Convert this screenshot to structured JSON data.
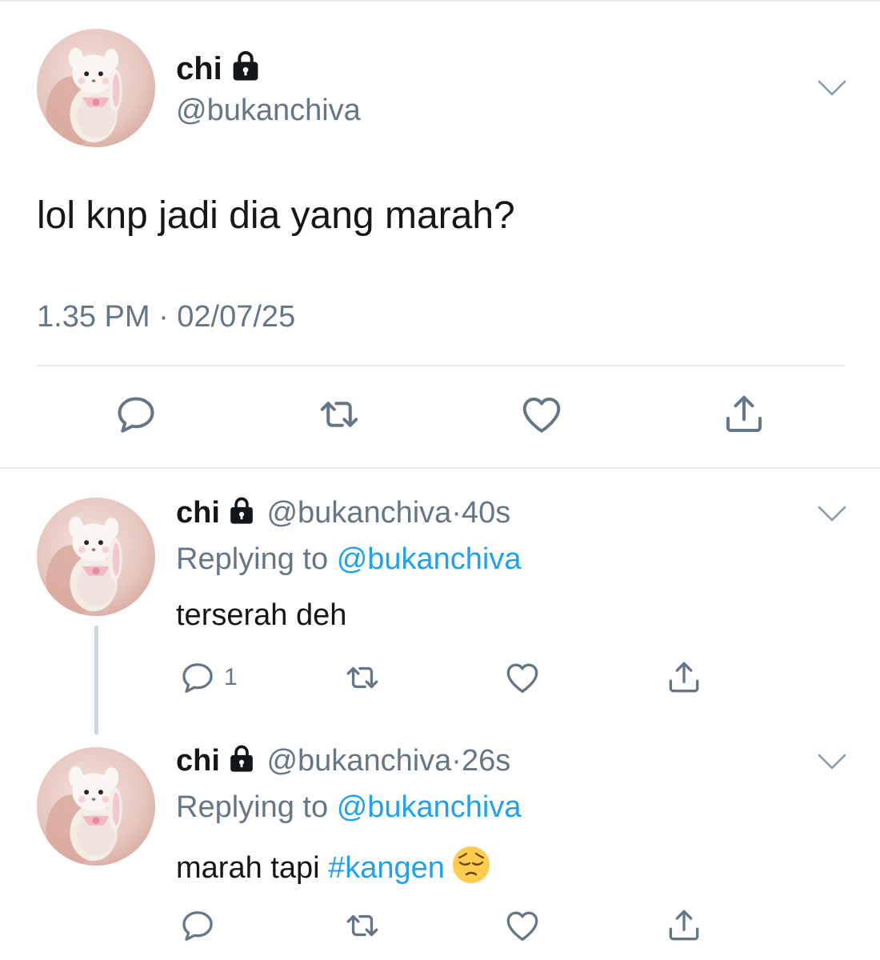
{
  "colors": {
    "text": "#14171a",
    "secondary": "#657786",
    "link": "#1da1f2",
    "divider": "#e6ecf0"
  },
  "main_tweet": {
    "name": "chi",
    "handle": "@bukanchiva",
    "text": "lol knp jadi dia yang marah?",
    "timestamp": "1.35 PM · 02/07/25",
    "icons": [
      "lock-icon",
      "chevron-down-icon",
      "reply-icon",
      "retweet-icon",
      "like-icon",
      "share-icon"
    ]
  },
  "replies": [
    {
      "name": "chi",
      "handle": "@bukanchiva",
      "separator": "·",
      "time": "40s",
      "replying_prefix": "Replying to",
      "replying_to": "@bukanchiva",
      "text": "terserah deh",
      "reply_count": "1"
    },
    {
      "name": "chi",
      "handle": "@bukanchiva",
      "separator": "·",
      "time": "26s",
      "replying_prefix": "Replying to",
      "replying_to": "@bukanchiva",
      "text_prefix": "marah tapi",
      "hashtag": "#kangen",
      "emoji": "pensive-face-emoji"
    }
  ]
}
